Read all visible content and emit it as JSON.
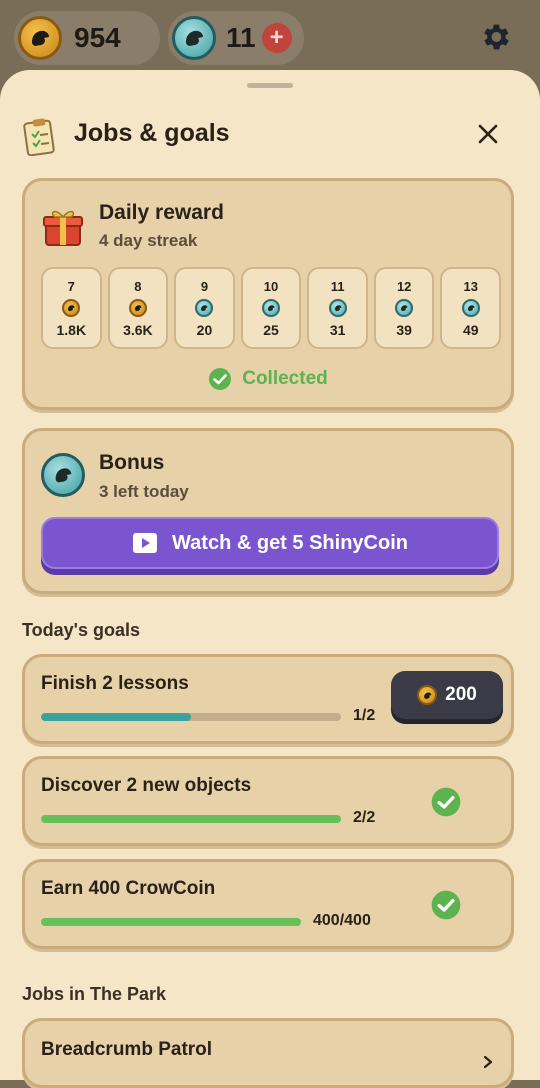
{
  "top_bar": {
    "crowcoin_amount": "954",
    "shinycoin_amount": "11",
    "add_label": "+"
  },
  "sheet": {
    "title": "Jobs & goals"
  },
  "daily_reward": {
    "title": "Daily reward",
    "streak": "4 day streak",
    "days": [
      {
        "day": "7",
        "coin": "gold",
        "amount": "1.8K"
      },
      {
        "day": "8",
        "coin": "gold",
        "amount": "3.6K"
      },
      {
        "day": "9",
        "coin": "teal",
        "amount": "20"
      },
      {
        "day": "10",
        "coin": "teal",
        "amount": "25"
      },
      {
        "day": "11",
        "coin": "teal",
        "amount": "31"
      },
      {
        "day": "12",
        "coin": "teal",
        "amount": "39"
      },
      {
        "day": "13",
        "coin": "teal",
        "amount": "49"
      }
    ],
    "status": "Collected"
  },
  "bonus": {
    "title": "Bonus",
    "subtitle": "3 left today",
    "button_label": "Watch & get 5 ShinyCoin"
  },
  "goals_section": {
    "title": "Today's goals",
    "goals": [
      {
        "title": "Finish 2 lessons",
        "progress_text": "1/2",
        "progress": 0.5,
        "state": "claim",
        "reward": "200"
      },
      {
        "title": "Discover 2 new objects",
        "progress_text": "2/2",
        "progress": 1.0,
        "state": "done"
      },
      {
        "title": "Earn 400 CrowCoin",
        "progress_text": "400/400",
        "progress": 1.0,
        "state": "done"
      }
    ]
  },
  "jobs_section": {
    "title": "Jobs in The Park",
    "jobs": [
      {
        "title": "Breadcrumb Patrol"
      }
    ]
  },
  "colors": {
    "bar_teal": "#3aa39c",
    "bar_green": "#67bf5a",
    "accent_purple": "#7b55d0"
  }
}
